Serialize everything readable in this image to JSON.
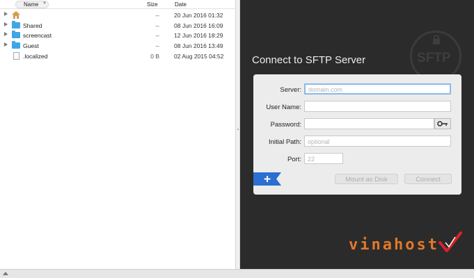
{
  "files_header": {
    "name": "Name",
    "size": "Size",
    "date": "Date"
  },
  "files": [
    {
      "name": "",
      "size": "--",
      "date": "20 Jun 2016 01:32",
      "icon": "home-folder-icon"
    },
    {
      "name": "Shared",
      "size": "--",
      "date": "08 Jun 2016 16:09",
      "icon": "folder-icon"
    },
    {
      "name": "screencast",
      "size": "--",
      "date": "12 Jun 2016 18:29",
      "icon": "folder-icon"
    },
    {
      "name": "Guest",
      "size": "--",
      "date": "08 Jun 2016 13:49",
      "icon": "folder-icon"
    },
    {
      "name": ".localized",
      "size": "0 B",
      "date": "02 Aug 2015 04:52",
      "icon": "document-icon"
    }
  ],
  "dialog": {
    "title": "Connect to SFTP Server",
    "stamp": "SFTP",
    "server_label": "Server:",
    "server_placeholder": "domain.com",
    "user_label": "User Name:",
    "password_label": "Password:",
    "path_label": "Initial Path:",
    "path_placeholder": "optional",
    "port_label": "Port:",
    "port_placeholder": "22",
    "mount_label": "Mount as Disk",
    "connect_label": "Connect"
  },
  "logo": "vinahost",
  "colors": {
    "dark_pane": "#2b2b2b",
    "folder": "#3ea6e6",
    "accent_blue": "#2a6fd1",
    "logo_orange": "#e2782a",
    "logo_red": "#d8232a"
  }
}
